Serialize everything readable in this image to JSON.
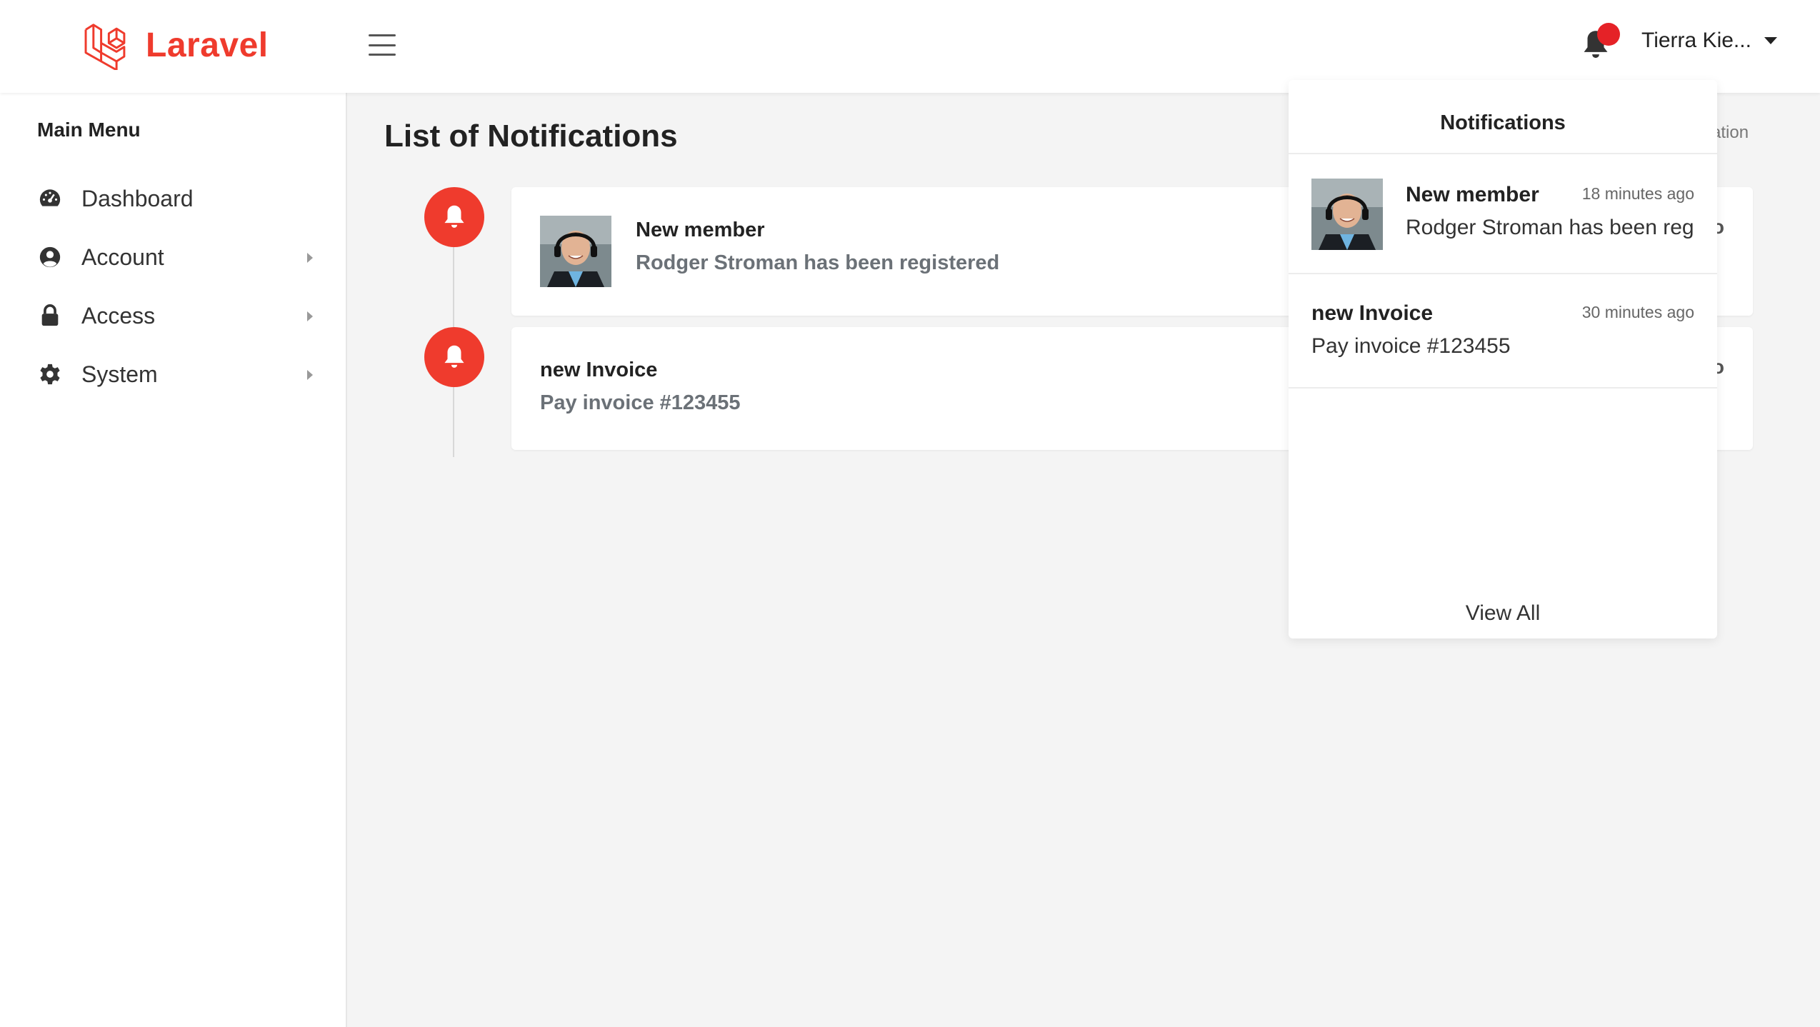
{
  "brand": {
    "name": "Laravel",
    "color": "#ef3b2d"
  },
  "header": {
    "menu_icon": "hamburger-icon",
    "notification_icon": "bell-icon",
    "user_name": "Tierra Kie..."
  },
  "sidebar": {
    "title": "Main Menu",
    "items": [
      {
        "label": "Dashboard",
        "icon": "dashboard-gauge-icon",
        "has_submenu": false
      },
      {
        "label": "Account",
        "icon": "user-circle-icon",
        "has_submenu": true
      },
      {
        "label": "Access",
        "icon": "lock-icon",
        "has_submenu": true
      },
      {
        "label": "System",
        "icon": "gear-icon",
        "has_submenu": true
      }
    ]
  },
  "main": {
    "title": "List of Notifications",
    "breadcrumb_tail": "ation",
    "timeline": [
      {
        "title": "New member",
        "text": "Rodger Stroman has been registered",
        "has_avatar": true,
        "edge": "o"
      },
      {
        "title": "new Invoice",
        "text": "Pay invoice #123455",
        "has_avatar": false,
        "edge": "o"
      }
    ]
  },
  "notifications_dropdown": {
    "title": "Notifications",
    "items": [
      {
        "title": "New member",
        "time": "18 minutes ago",
        "text": "Rodger Stroman has been registered",
        "has_avatar": true
      },
      {
        "title": "new Invoice",
        "time": "30 minutes ago",
        "text": "Pay invoice #123455",
        "has_avatar": false
      }
    ],
    "footer": "View All"
  },
  "colors": {
    "accent": "#ef3b2d",
    "badge": "#e52227",
    "muted_text": "#6b7177",
    "background": "#f4f4f4"
  }
}
